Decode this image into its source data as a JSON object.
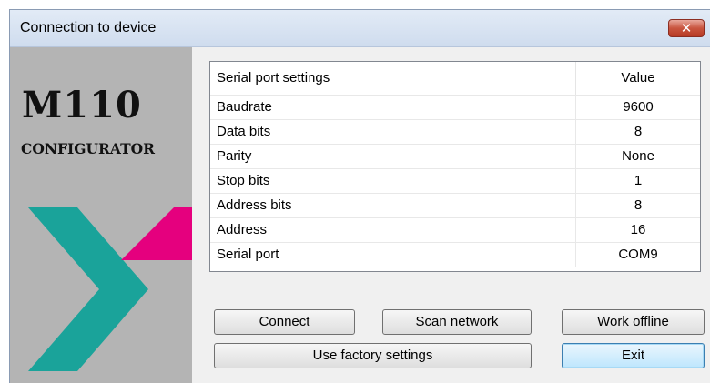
{
  "window": {
    "title": "Connection to device",
    "close_symbol": "✕"
  },
  "side_panel": {
    "logo_main": "M110",
    "logo_sub": "CONFIGURATOR",
    "colors": {
      "background": "#b4b4b4",
      "teal": "#1aa39a",
      "magenta": "#e5007e"
    }
  },
  "settings_table": {
    "headers": [
      "Serial port settings",
      "Value"
    ],
    "rows": [
      {
        "name": "Baudrate",
        "value": "9600"
      },
      {
        "name": "Data bits",
        "value": "8"
      },
      {
        "name": "Parity",
        "value": "None"
      },
      {
        "name": "Stop bits",
        "value": "1"
      },
      {
        "name": "Address bits",
        "value": "8"
      },
      {
        "name": "Address",
        "value": "16"
      },
      {
        "name": "Serial port",
        "value": "COM9"
      }
    ]
  },
  "buttons": {
    "connect": "Connect",
    "scan_network": "Scan network",
    "work_offline": "Work offline",
    "factory_settings": "Use factory settings",
    "exit": "Exit"
  }
}
